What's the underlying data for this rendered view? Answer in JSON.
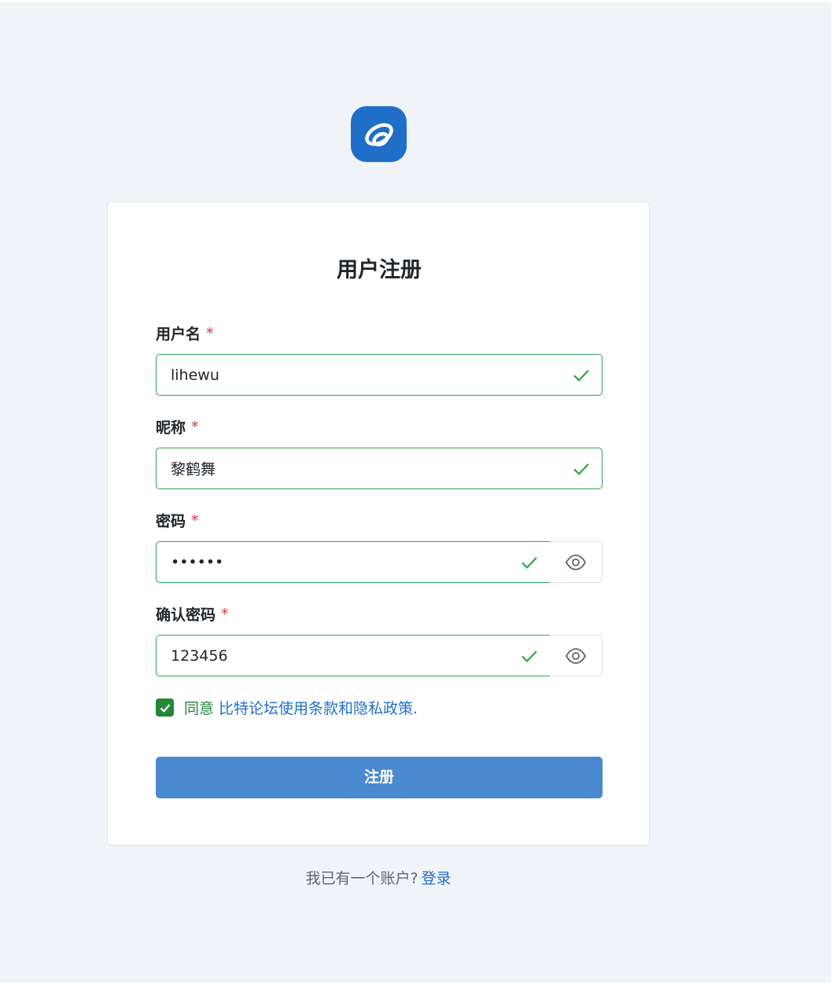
{
  "brand": {
    "logo_icon": "forum-logo-icon",
    "color": "#1f6fc9"
  },
  "form": {
    "title": "用户注册",
    "required_mark": "*",
    "username": {
      "label": "用户名",
      "value": "lihewu"
    },
    "nickname": {
      "label": "昵称",
      "value": "黎鹤舞"
    },
    "password": {
      "label": "密码",
      "value": "123456"
    },
    "confirm_password": {
      "label": "确认密码",
      "value": "123456"
    },
    "agree": {
      "checked": true,
      "text": "同意",
      "link_text": "比特论坛使用条款和隐私政策."
    },
    "submit_label": "注册"
  },
  "footer": {
    "text": "我已有一个账户?",
    "login_link": "登录"
  },
  "colors": {
    "valid": "#2fa44f",
    "primary": "#4a89d0",
    "required": "#dc3545",
    "link": "#1f6fc9"
  }
}
